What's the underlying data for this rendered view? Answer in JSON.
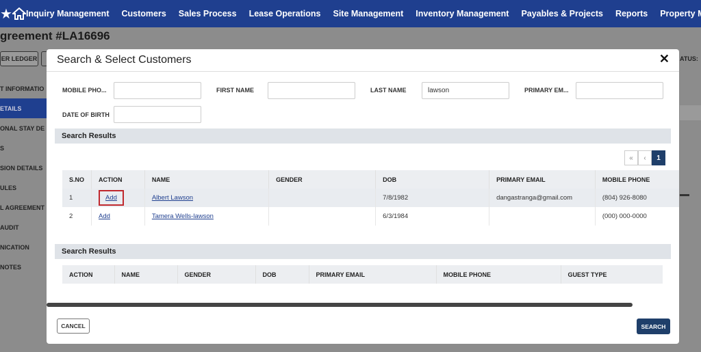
{
  "nav": {
    "items": [
      "Inquiry Management",
      "Customers",
      "Sales Process",
      "Lease Operations",
      "Site Management",
      "Inventory Management",
      "Payables & Projects",
      "Reports",
      "Property Manage"
    ]
  },
  "background": {
    "title": "greement #LA16696",
    "ledger_btn": "ER LEDGER",
    "status_label": "ATUS:",
    "sidebar": [
      "T INFORMATIO",
      "ETAILS",
      "ONAL STAY DE",
      "S",
      "SION DETAILS",
      "ULES",
      "L AGREEMENT",
      "AUDIT",
      "NICATION",
      "NOTES"
    ]
  },
  "modal": {
    "title": "Search & Select Customers",
    "close_glyph": "✕",
    "fields": {
      "mobile_label": "MOBILE PHO...",
      "first_name_label": "FIRST NAME",
      "last_name_label": "LAST NAME",
      "last_name_value": "lawson",
      "primary_email_label": "PRIMARY EM...",
      "dob_label": "DATE OF BIRTH"
    },
    "search_results_1": "Search Results",
    "pager": {
      "first": "«",
      "prev": "‹",
      "page": "1"
    },
    "table1": {
      "headers": [
        "S.NO",
        "ACTION",
        "NAME",
        "GENDER",
        "DOB",
        "PRIMARY EMAIL",
        "MOBILE PHONE"
      ],
      "rows": [
        {
          "sno": "1",
          "action": "Add",
          "name": "Albert Lawson",
          "gender": "",
          "dob": "7/8/1982",
          "email": "dangastranga@gmail.com",
          "phone": "(804) 926-8080"
        },
        {
          "sno": "2",
          "action": "Add",
          "name": "Tamera Wells-lawson",
          "gender": "",
          "dob": "6/3/1984",
          "email": "",
          "phone": "(000) 000-0000"
        }
      ]
    },
    "search_results_2": "Search Results",
    "table2": {
      "headers": [
        "ACTION",
        "NAME",
        "GENDER",
        "DOB",
        "PRIMARY EMAIL",
        "MOBILE PHONE",
        "GUEST TYPE"
      ]
    },
    "cancel_label": "CANCEL",
    "search_label": "SEARCH"
  }
}
